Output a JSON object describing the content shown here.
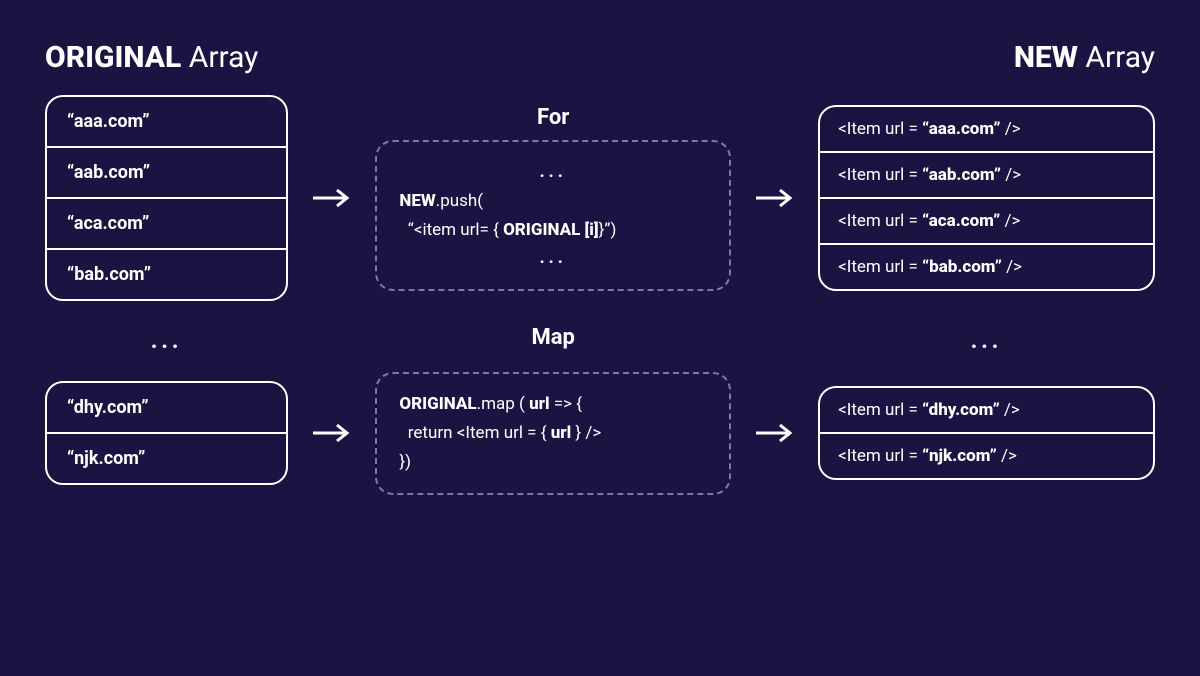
{
  "headers": {
    "original_bold": "ORIGINAL",
    "original_rest": " Array",
    "new_bold": "NEW",
    "new_rest": " Array"
  },
  "original_top": [
    "“aaa.com”",
    "“aab.com”",
    "“aca.com”",
    "“bab.com”"
  ],
  "original_bot": [
    "“dhy.com”",
    "“njk.com”"
  ],
  "new_top_prefix": "<Item url = ",
  "new_top_suffix": " />",
  "new_top": [
    "“aaa.com”",
    "“aab.com”",
    "“aca.com”",
    "“bab.com”"
  ],
  "new_bot": [
    "“dhy.com”",
    "“njk.com”"
  ],
  "for": {
    "label": "For",
    "ellipsis": "...",
    "line1_b": "NEW",
    "line1_rest": ".push(",
    "line2_pre": "  “<item url= { ",
    "line2_b": "ORIGINAL [i]",
    "line2_post": "}”)"
  },
  "map": {
    "label": "Map",
    "line1_b": "ORIGINAL",
    "line1_mid": ".map ( ",
    "line1_b2": "url",
    "line1_post": " => {",
    "line2_pre": "  return <Item url = { ",
    "line2_b": "url",
    "line2_post": " } />",
    "line3": "})"
  },
  "ellipsis": "..."
}
